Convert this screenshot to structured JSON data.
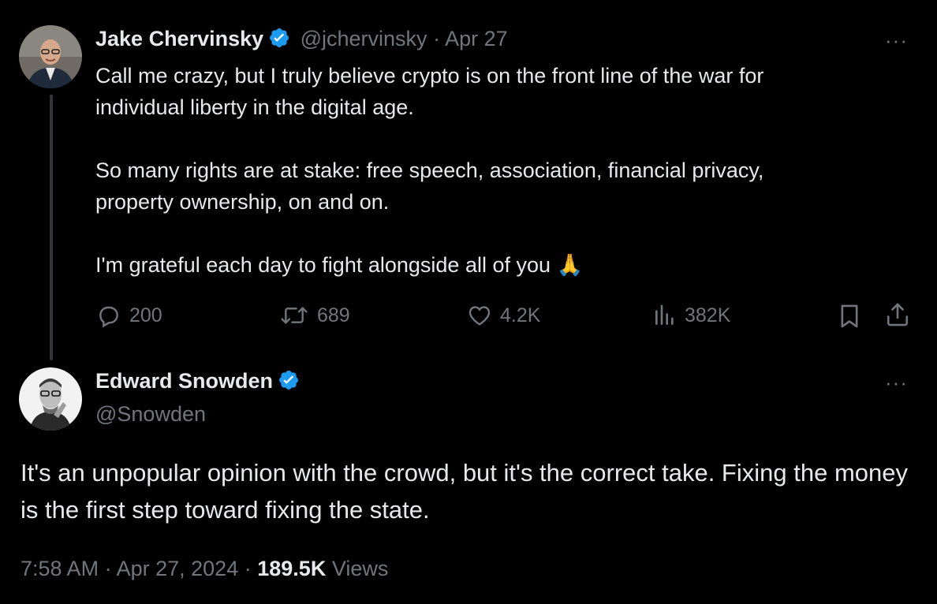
{
  "original_tweet": {
    "author_name": "Jake Chervinsky",
    "handle": "@jchervinsky",
    "separator": "·",
    "date": "Apr 27",
    "text": "Call me crazy, but I truly believe crypto is on the front line of the war for\nindividual liberty in the digital age.\n\nSo many rights are at stake: free speech, association, financial privacy,\nproperty ownership, on and on.\n\nI'm grateful each day to fight alongside all of you 🙏",
    "metrics": {
      "replies": "200",
      "reposts": "689",
      "likes": "4.2K",
      "views": "382K"
    },
    "more_label": "···"
  },
  "reply_tweet": {
    "author_name": "Edward Snowden",
    "handle": "@Snowden",
    "text": "It's an unpopular opinion with the crowd, but it's the correct take. Fixing the money is the first step toward fixing the state.",
    "time": "7:58 AM",
    "separator": "·",
    "date": "Apr 27, 2024",
    "views_count": "189.5K",
    "views_label": "Views",
    "more_label": "···"
  },
  "colors": {
    "background": "#000000",
    "text": "#e7e9ea",
    "muted": "#71767b",
    "verified": "#1d9bf0"
  },
  "icons": [
    "reply-icon",
    "repost-icon",
    "like-icon",
    "views-icon",
    "bookmark-icon",
    "share-icon",
    "verified-badge-icon",
    "more-icon"
  ]
}
